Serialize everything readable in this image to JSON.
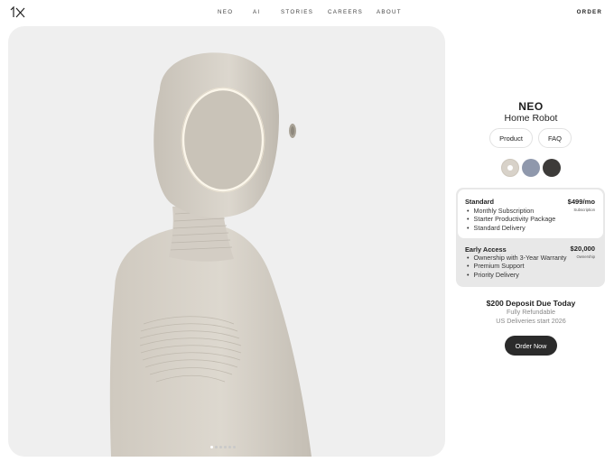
{
  "nav": {
    "logo": "1X",
    "links": [
      "NEO",
      "AI",
      "STORIES",
      "CAREERS",
      "ABOUT"
    ],
    "order": "ORDER"
  },
  "hero": {
    "image": "robot-side-profile",
    "carousel_count": 6,
    "carousel_active": 1
  },
  "product": {
    "name": "NEO",
    "tagline": "Home Robot",
    "tabs": [
      "Product",
      "FAQ"
    ],
    "swatches": [
      "#d8d2c9",
      "#8f98ac",
      "#3d3b39"
    ]
  },
  "plans": {
    "standard": {
      "name": "Standard",
      "price": "$499/mo",
      "note": "Subscription",
      "features": [
        "Monthly Subscription",
        "Starter Productivity Package",
        "Standard Delivery"
      ]
    },
    "early": {
      "name": "Early Access",
      "price": "$20,000",
      "note": "Ownership",
      "features": [
        "Ownership with 3-Year Warranty",
        "Premium Support",
        "Priority Delivery"
      ]
    }
  },
  "deposit": {
    "headline": "$200 Deposit Due Today",
    "refundable": "Fully Refundable",
    "deliveries": "US Deliveries start 2026"
  },
  "cta": {
    "order_now": "Order Now"
  }
}
